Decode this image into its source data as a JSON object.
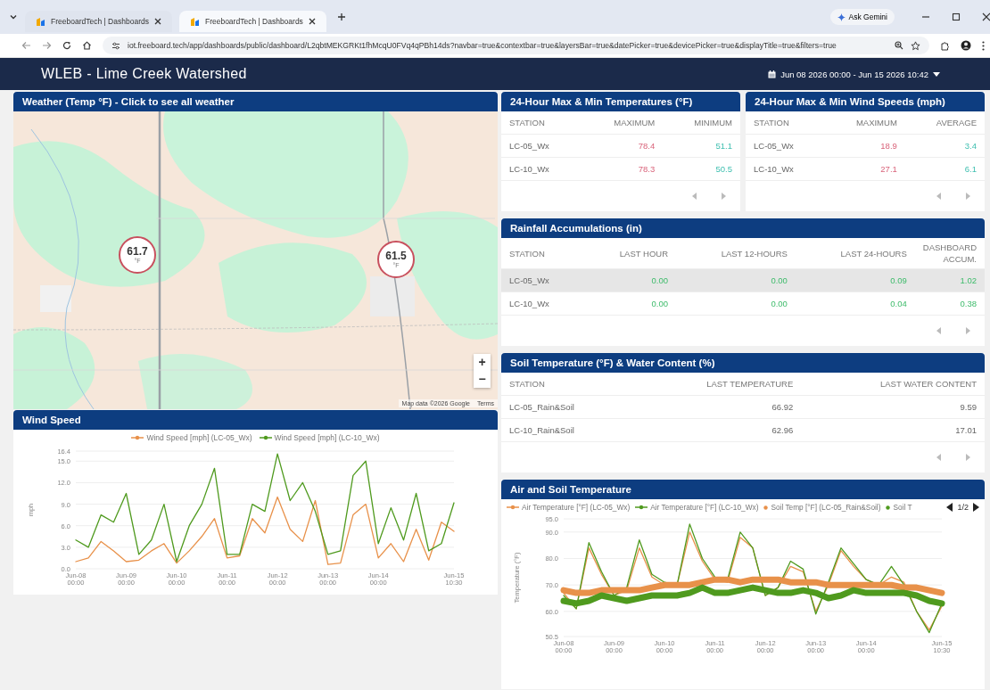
{
  "browser": {
    "tabs": [
      {
        "title": "FreeboardTech | Dashboards",
        "selected": false
      },
      {
        "title": "FreeboardTech | Dashboards",
        "selected": true
      }
    ],
    "ask_button": "Ask Gemini",
    "url": "iot.freeboard.tech/app/dashboards/public/dashboard/L2qbtMEKGRKt1fhMcqU0FVq4qPBh14ds?navbar=true&contextbar=true&layersBar=true&datePicker=true&devicePicker=true&displayTitle=true&filters=true"
  },
  "dashboard": {
    "title": "WLEB - Lime Creek Watershed",
    "date_range": "Jun 08 2026 00:00 - Jun 15 2026 10:42"
  },
  "weather_map": {
    "title": "Weather (Temp °F) - Click to see all weather",
    "markers": [
      {
        "value": "61.7",
        "unit": "°F"
      },
      {
        "value": "61.5",
        "unit": "°F"
      }
    ],
    "zoom_in": "+",
    "zoom_out": "−",
    "attribution": "Map data ©2026 Google",
    "terms": "Terms"
  },
  "wind_speed": {
    "title": "Wind Speed",
    "chart_data": {
      "type": "line",
      "ylabel": "mph",
      "grid": true,
      "categories": [
        "Jun-08 00:00",
        null,
        null,
        null,
        "Jun-09 00:00",
        null,
        null,
        null,
        "Jun-10 00:00",
        null,
        null,
        null,
        "Jun-11 00:00",
        null,
        null,
        null,
        "Jun-12 00:00",
        null,
        null,
        null,
        "Jun-13 00:00",
        null,
        null,
        null,
        "Jun-14 00:00",
        null,
        null,
        null,
        null,
        null,
        "Jun-15 10:30"
      ],
      "ylim": [
        0,
        16.4
      ],
      "yticks": [
        {
          "value": 0,
          "label": "0.0"
        },
        {
          "value": 3,
          "label": "3.0"
        },
        {
          "value": 6,
          "label": "6.0"
        },
        {
          "value": 9,
          "label": "9.0"
        },
        {
          "value": 12,
          "label": "12.0"
        },
        {
          "value": 15,
          "label": "15.0"
        },
        {
          "value": 16.4,
          "label": "16.4"
        }
      ],
      "series": [
        {
          "name": "Wind Speed [mph] (LC-05_Wx)",
          "color": "#e8914a",
          "values": [
            1.0,
            1.5,
            3.8,
            2.5,
            1.0,
            1.2,
            2.5,
            3.5,
            0.8,
            2.5,
            4.5,
            7.0,
            1.5,
            1.8,
            7.0,
            5.0,
            10.0,
            5.5,
            3.8,
            9.5,
            0.6,
            0.8,
            7.5,
            9.0,
            1.5,
            3.5,
            1.0,
            5.5,
            1.2,
            6.5,
            5.2
          ]
        },
        {
          "name": "Wind Speed [mph] (LC-10_Wx)",
          "color": "#4f9a1e",
          "values": [
            4.0,
            3.0,
            7.5,
            6.5,
            10.5,
            2.0,
            4.0,
            9.0,
            1.0,
            6.0,
            9.0,
            14.0,
            2.0,
            2.0,
            9.0,
            8.0,
            16.0,
            9.5,
            12.0,
            8.0,
            2.0,
            2.5,
            13.0,
            15.0,
            3.5,
            8.5,
            4.0,
            10.5,
            2.5,
            3.5,
            9.2
          ]
        }
      ]
    }
  },
  "max_min_temperatures": {
    "title": "24-Hour Max & Min Temperatures (°F)",
    "columns": [
      {
        "label": "STATION",
        "kind": "station"
      },
      {
        "label": "MAXIMUM",
        "kind": "high"
      },
      {
        "label": "MINIMUM",
        "kind": "low"
      }
    ],
    "rows": [
      {
        "cells": [
          "LC-05_Wx",
          "78.4",
          "51.1"
        ],
        "highlighted": false
      },
      {
        "cells": [
          "LC-10_Wx",
          "78.3",
          "50.5"
        ],
        "highlighted": false
      }
    ]
  },
  "max_min_wind_speeds": {
    "title": "24-Hour Max & Min Wind Speeds (mph)",
    "columns": [
      {
        "label": "STATION",
        "kind": "station"
      },
      {
        "label": "MAXIMUM",
        "kind": "high"
      },
      {
        "label": "AVERAGE",
        "kind": "low"
      }
    ],
    "rows": [
      {
        "cells": [
          "LC-05_Wx",
          "18.9",
          "3.4"
        ],
        "highlighted": false
      },
      {
        "cells": [
          "LC-10_Wx",
          "27.1",
          "6.1"
        ],
        "highlighted": false
      }
    ]
  },
  "rainfall_accumulations": {
    "title": "Rainfall Accumulations (in)",
    "columns": [
      {
        "label": "STATION",
        "kind": "station"
      },
      {
        "label": "LAST HOUR",
        "kind": "rain"
      },
      {
        "label": "LAST 12-HOURS",
        "kind": "rain"
      },
      {
        "label": "LAST 24-HOURS",
        "kind": "rain"
      },
      {
        "label": "DASHBOARD ACCUM.",
        "kind": "rain"
      }
    ],
    "rows": [
      {
        "cells": [
          "LC-05_Wx",
          "0.00",
          "0.00",
          "0.09",
          "1.02"
        ],
        "highlighted": true
      },
      {
        "cells": [
          "LC-10_Wx",
          "0.00",
          "0.00",
          "0.04",
          "0.38"
        ],
        "highlighted": false
      }
    ]
  },
  "soil_temperature_water": {
    "title": "Soil Temperature (°F) & Water Content (%)",
    "columns": [
      {
        "label": "STATION",
        "kind": "station"
      },
      {
        "label": "LAST TEMPERATURE",
        "kind": "plain"
      },
      {
        "label": "LAST WATER CONTENT",
        "kind": "plain"
      }
    ],
    "rows": [
      {
        "cells": [
          "LC-05_Rain&Soil",
          "66.92",
          "9.59"
        ],
        "highlighted": false
      },
      {
        "cells": [
          "LC-10_Rain&Soil",
          "62.96",
          "17.01"
        ],
        "highlighted": false
      }
    ]
  },
  "air_soil_temperature": {
    "title": "Air and Soil Temperature",
    "legend_page": "1/2",
    "chart_data": {
      "type": "line",
      "ylabel": "Temperature (°F)",
      "grid": true,
      "categories": [
        "Jun-08 00:00",
        null,
        null,
        null,
        "Jun-09 00:00",
        null,
        null,
        null,
        "Jun-10 00:00",
        null,
        null,
        null,
        "Jun-11 00:00",
        null,
        null,
        null,
        "Jun-12 00:00",
        null,
        null,
        null,
        "Jun-13 00:00",
        null,
        null,
        null,
        "Jun-14 00:00",
        null,
        null,
        null,
        null,
        null,
        "Jun-15 10:30"
      ],
      "ylim": [
        50.5,
        95
      ],
      "yticks": [
        {
          "value": 50.5,
          "label": "50.5"
        },
        {
          "value": 60,
          "label": "60.0"
        },
        {
          "value": 70,
          "label": "70.0"
        },
        {
          "value": 80,
          "label": "80.0"
        },
        {
          "value": 90,
          "label": "90.0"
        },
        {
          "value": 95,
          "label": "95.0"
        }
      ],
      "series": [
        {
          "name": "Air Temperature [°F] (LC-05_Wx)",
          "color": "#e8914a",
          "values": [
            67,
            61,
            84,
            74,
            66,
            68,
            84,
            73,
            70,
            70,
            90,
            79,
            72,
            71,
            88,
            84,
            66,
            69,
            77,
            75,
            60,
            70,
            83,
            77,
            72,
            70,
            73,
            71,
            60,
            53,
            62
          ]
        },
        {
          "name": "Air Temperature [°F] (LC-10_Wx)",
          "color": "#4f9a1e",
          "values": [
            66,
            61,
            86,
            75,
            66,
            69,
            87,
            74,
            71,
            70,
            93,
            80,
            73,
            72,
            90,
            84,
            66,
            69,
            79,
            76,
            59,
            71,
            84,
            78,
            72,
            70,
            77,
            70,
            60,
            52,
            63
          ]
        },
        {
          "name": "Soil Temp [°F] (LC-05_Rain&Soil)",
          "color": "#e8914a",
          "values": [
            68,
            67,
            67,
            68,
            68,
            68,
            68,
            69,
            70,
            70,
            70,
            71,
            72,
            72,
            71,
            72,
            72,
            72,
            71,
            71,
            71,
            70,
            70,
            70,
            70,
            70,
            70,
            69,
            69,
            68,
            67
          ]
        },
        {
          "name": "Soil T",
          "color": "#4f9a1e",
          "values": [
            64,
            63,
            64,
            66,
            65,
            64,
            65,
            66,
            66,
            66,
            67,
            69,
            67,
            67,
            68,
            69,
            68,
            67,
            67,
            68,
            67,
            65,
            66,
            68,
            67,
            67,
            67,
            67,
            66,
            64,
            63
          ]
        }
      ]
    }
  }
}
